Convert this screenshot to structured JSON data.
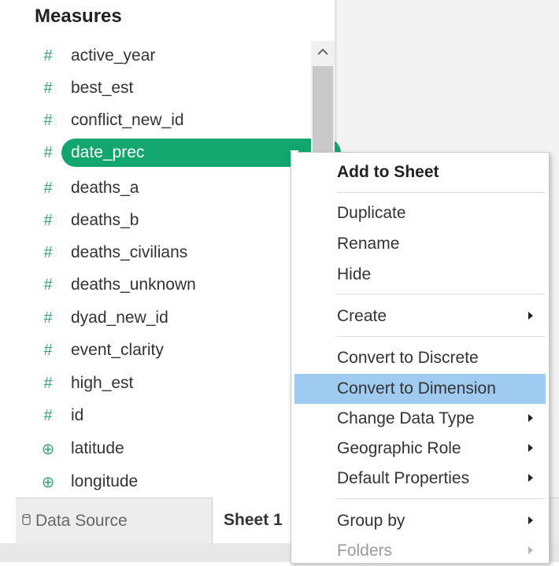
{
  "data_pane": {
    "header": "Measures",
    "fields": [
      {
        "name": "active_year",
        "icon": "hash-icon",
        "glyph": "#"
      },
      {
        "name": "best_est",
        "icon": "hash-icon",
        "glyph": "#"
      },
      {
        "name": "conflict_new_id",
        "icon": "hash-icon",
        "glyph": "#"
      },
      {
        "name": "date_prec",
        "icon": "hash-icon",
        "glyph": "#",
        "selected": true
      },
      {
        "name": "deaths_a",
        "icon": "hash-icon",
        "glyph": "#"
      },
      {
        "name": "deaths_b",
        "icon": "hash-icon",
        "glyph": "#"
      },
      {
        "name": "deaths_civilians",
        "icon": "hash-icon",
        "glyph": "#"
      },
      {
        "name": "deaths_unknown",
        "icon": "hash-icon",
        "glyph": "#"
      },
      {
        "name": "dyad_new_id",
        "icon": "hash-icon",
        "glyph": "#"
      },
      {
        "name": "event_clarity",
        "icon": "hash-icon",
        "glyph": "#"
      },
      {
        "name": "high_est",
        "icon": "hash-icon",
        "glyph": "#"
      },
      {
        "name": "id",
        "icon": "hash-icon",
        "glyph": "#"
      },
      {
        "name": "latitude",
        "icon": "globe-icon",
        "glyph": "⊕"
      },
      {
        "name": "longitude",
        "icon": "globe-icon",
        "glyph": "⊕"
      }
    ]
  },
  "context_menu": {
    "add_to_sheet": "Add to Sheet",
    "duplicate": "Duplicate",
    "rename": "Rename",
    "hide": "Hide",
    "create": "Create",
    "convert_discrete": "Convert to Discrete",
    "convert_dimension": "Convert to Dimension",
    "change_data_type": "Change Data Type",
    "geographic_role": "Geographic Role",
    "default_properties": "Default Properties",
    "group_by": "Group by",
    "folders": "Folders"
  },
  "tabs": {
    "data_source": "Data Source",
    "data_source_icon": "database-icon",
    "sheet1": "Sheet 1"
  },
  "colors": {
    "accent_green": "#13a56e",
    "field_icon_green": "#44a47a",
    "menu_highlight": "#9fcbf0"
  }
}
